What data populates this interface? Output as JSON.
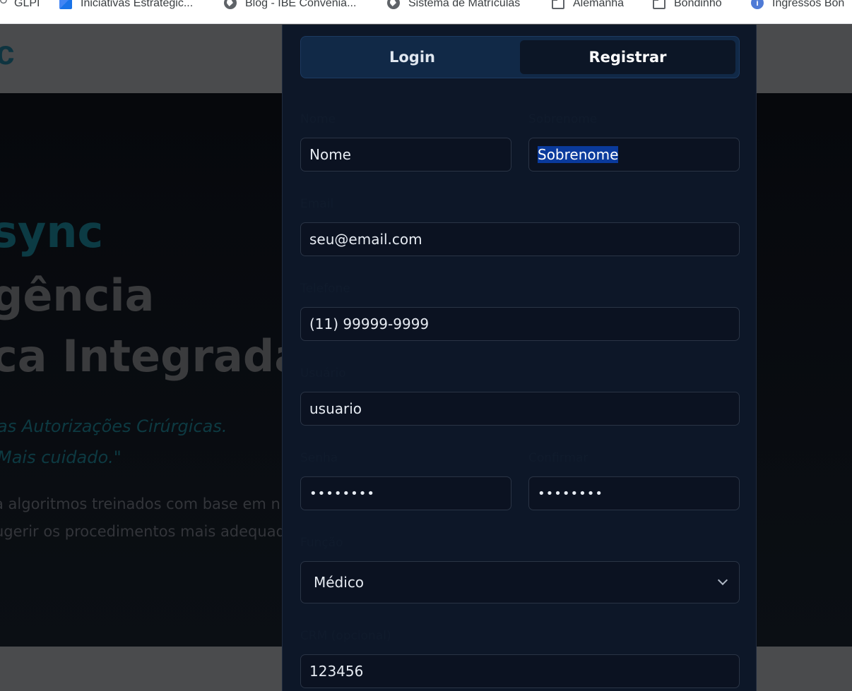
{
  "bookmarks": [
    {
      "label": "GLPI",
      "icon": "glpi-icon"
    },
    {
      "label": "Iniciativas Estratégic...",
      "icon": "cube-icon"
    },
    {
      "label": "Blog - IBE Convenia...",
      "icon": "globe-icon"
    },
    {
      "label": "Sistema de Matrículas",
      "icon": "globe-icon"
    },
    {
      "label": "Alemanha",
      "icon": "folder-icon"
    },
    {
      "label": "Bondinho",
      "icon": "folder-icon"
    },
    {
      "label": "Ingressos Bon",
      "icon": "info-icon"
    }
  ],
  "background": {
    "logo": "c",
    "hero_line_1": "sync",
    "hero_line_2": "gência",
    "hero_line_3": "ca Integrada",
    "quote_1": "as Autorizações Cirúrgicas.",
    "quote_2": "Mais cuidado.\"",
    "desc_1": "a algoritmos treinados com base em n",
    "desc_2": "ugerir os procedimentos mais adequad"
  },
  "modal": {
    "tabs": {
      "login": "Login",
      "register": "Registrar"
    },
    "labels": {
      "nome": "Nome",
      "sobrenome": "Sobrenome",
      "email": "Email",
      "telefone": "Telefone",
      "usuario": "Usuário",
      "senha": "Senha",
      "confirmar": "Confirmar",
      "funcao": "Função",
      "crm": "CRM (opcional)"
    },
    "values": {
      "nome": "Nome",
      "sobrenome": "Sobrenome",
      "email": "seu@email.com",
      "telefone": "(11) 99999-9999",
      "usuario": "usuario",
      "senha": "••••••••",
      "confirmar": "••••••••",
      "funcao": "Médico",
      "crm": "123456"
    }
  },
  "colors": {
    "modal_bg": "#0d1728",
    "input_bg": "#0b1221",
    "tab_bar_bg": "#112947",
    "selection": "#0a3a9c"
  }
}
